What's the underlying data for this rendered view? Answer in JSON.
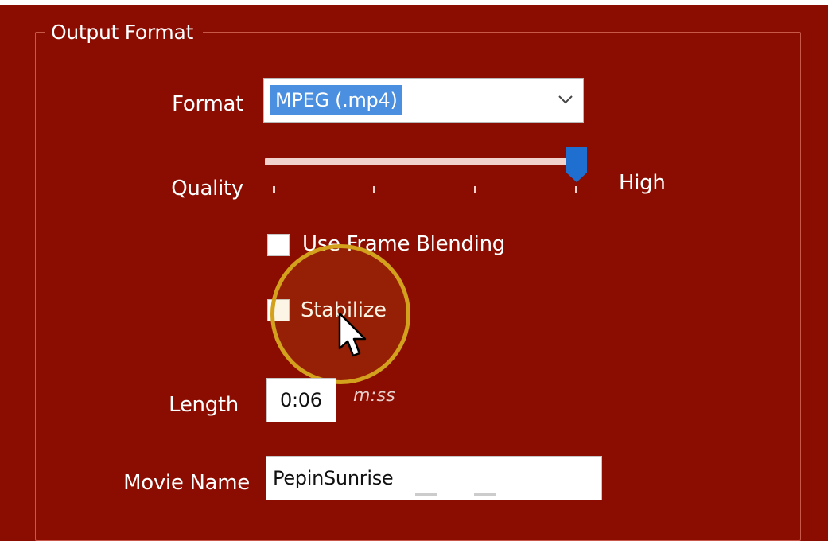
{
  "group": {
    "title": "Output Format"
  },
  "format": {
    "label": "Format",
    "selected": "MPEG (.mp4)"
  },
  "quality": {
    "label": "Quality",
    "high_label": "High",
    "level_fraction": 1.0
  },
  "options": {
    "frame_blending": {
      "label": "Use Frame Blending",
      "checked": false
    },
    "stabilize": {
      "label": "Stabilize",
      "checked": false
    }
  },
  "length": {
    "label": "Length",
    "value": "0:06",
    "unit_hint": "m:ss"
  },
  "movie_name": {
    "label": "Movie Name",
    "value": "PepinSunrise"
  },
  "colors": {
    "background": "#8b0d02",
    "selection": "#4a8fe0",
    "slider_thumb": "#1f6fd1",
    "highlight_ring": "#d4a11c"
  }
}
